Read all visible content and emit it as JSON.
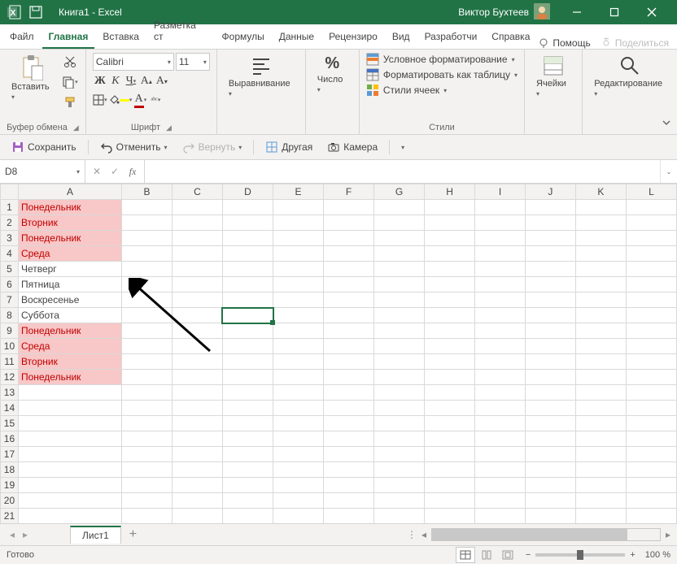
{
  "titlebar": {
    "doc_title": "Книга1",
    "app_suffix": " - Excel",
    "user": "Виктор Бухтеев"
  },
  "menu": {
    "items": [
      "Файл",
      "Главная",
      "Вставка",
      "Разметка ст",
      "Формулы",
      "Данные",
      "Рецензиро",
      "Вид",
      "Разработчи",
      "Справка"
    ],
    "active_index": 1,
    "help": "Помощь",
    "share": "Поделиться"
  },
  "ribbon": {
    "clipboard": {
      "paste": "Вставить",
      "label": "Буфер обмена"
    },
    "font": {
      "name": "Calibri",
      "size": "11",
      "bold": "Ж",
      "italic": "К",
      "underline": "Ч",
      "label": "Шрифт"
    },
    "align": {
      "label": "Выравнивание"
    },
    "number": {
      "label": "Число",
      "percent": "%"
    },
    "styles": {
      "cond": "Условное форматирование",
      "table": "Форматировать как таблицу",
      "cell": "Стили ячеек",
      "label": "Стили"
    },
    "cells": {
      "label": "Ячейки"
    },
    "editing": {
      "label": "Редактирование"
    }
  },
  "qat": {
    "save": "Сохранить",
    "undo": "Отменить",
    "redo": "Вернуть",
    "other": "Другая",
    "camera": "Камера"
  },
  "namebox": {
    "ref": "D8"
  },
  "columns": [
    "A",
    "B",
    "C",
    "D",
    "E",
    "F",
    "G",
    "H",
    "I",
    "J",
    "K",
    "L"
  ],
  "rows": [
    {
      "n": 1,
      "a": "Понедельник",
      "hl": true
    },
    {
      "n": 2,
      "a": "Вторник",
      "hl": true
    },
    {
      "n": 3,
      "a": "Понедельник",
      "hl": true
    },
    {
      "n": 4,
      "a": "Среда",
      "hl": true
    },
    {
      "n": 5,
      "a": "Четверг",
      "hl": false
    },
    {
      "n": 6,
      "a": "Пятница",
      "hl": false
    },
    {
      "n": 7,
      "a": "Воскресенье",
      "hl": false
    },
    {
      "n": 8,
      "a": "Суббота",
      "hl": false
    },
    {
      "n": 9,
      "a": "Понедельник",
      "hl": true
    },
    {
      "n": 10,
      "a": "Среда",
      "hl": true
    },
    {
      "n": 11,
      "a": "Вторник",
      "hl": true
    },
    {
      "n": 12,
      "a": "Понедельник",
      "hl": true
    },
    {
      "n": 13,
      "a": "",
      "hl": false
    },
    {
      "n": 14,
      "a": "",
      "hl": false
    },
    {
      "n": 15,
      "a": "",
      "hl": false
    },
    {
      "n": 16,
      "a": "",
      "hl": false
    },
    {
      "n": 17,
      "a": "",
      "hl": false
    },
    {
      "n": 18,
      "a": "",
      "hl": false
    },
    {
      "n": 19,
      "a": "",
      "hl": false
    },
    {
      "n": 20,
      "a": "",
      "hl": false
    },
    {
      "n": 21,
      "a": "",
      "hl": false
    }
  ],
  "active_cell": {
    "row": 8,
    "col": "D"
  },
  "sheets": {
    "name": "Лист1"
  },
  "status": {
    "ready": "Готово",
    "zoom": "100 %"
  }
}
